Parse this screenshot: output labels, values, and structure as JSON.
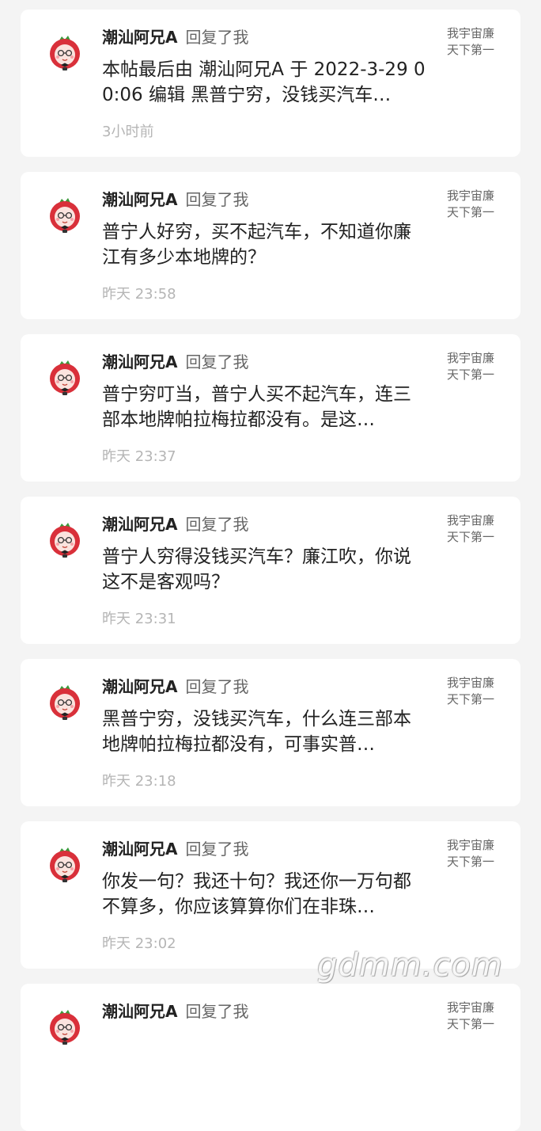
{
  "notifications": [
    {
      "username": "潮汕阿兄A",
      "action": "回复了我",
      "content": "本帖最后由 潮汕阿兄A 于 2022-3-29 00:06 编辑  黑普宁穷，没钱买汽车…",
      "time": "3小时前",
      "quote": "我宇宙廉天下第一"
    },
    {
      "username": "潮汕阿兄A",
      "action": "回复了我",
      "content": "普宁人好穷，买不起汽车，不知道你廉江有多少本地牌的？",
      "time": "昨天 23:58",
      "quote": "我宇宙廉天下第一"
    },
    {
      "username": "潮汕阿兄A",
      "action": "回复了我",
      "content": "普宁穷叮当，普宁人买不起汽车，连三部本地牌帕拉梅拉都没有。是这…",
      "time": "昨天 23:37",
      "quote": "我宇宙廉天下第一"
    },
    {
      "username": "潮汕阿兄A",
      "action": "回复了我",
      "content": "普宁人穷得没钱买汽车？廉江吹，你说这不是客观吗？",
      "time": "昨天 23:31",
      "quote": "我宇宙廉天下第一"
    },
    {
      "username": "潮汕阿兄A",
      "action": "回复了我",
      "content": "黑普宁穷，没钱买汽车，什么连三部本地牌帕拉梅拉都没有，可事实普…",
      "time": "昨天 23:18",
      "quote": "我宇宙廉天下第一"
    },
    {
      "username": "潮汕阿兄A",
      "action": "回复了我",
      "content": "你发一句？我还十句？我还你一万句都不算多，你应该算算你们在非珠…",
      "time": "昨天 23:02",
      "quote": "我宇宙廉天下第一"
    },
    {
      "username": "潮汕阿兄A",
      "action": "回复了我",
      "content": "",
      "time": "",
      "quote": "我宇宙廉天下第一"
    }
  ],
  "watermark": "gdmm.com"
}
